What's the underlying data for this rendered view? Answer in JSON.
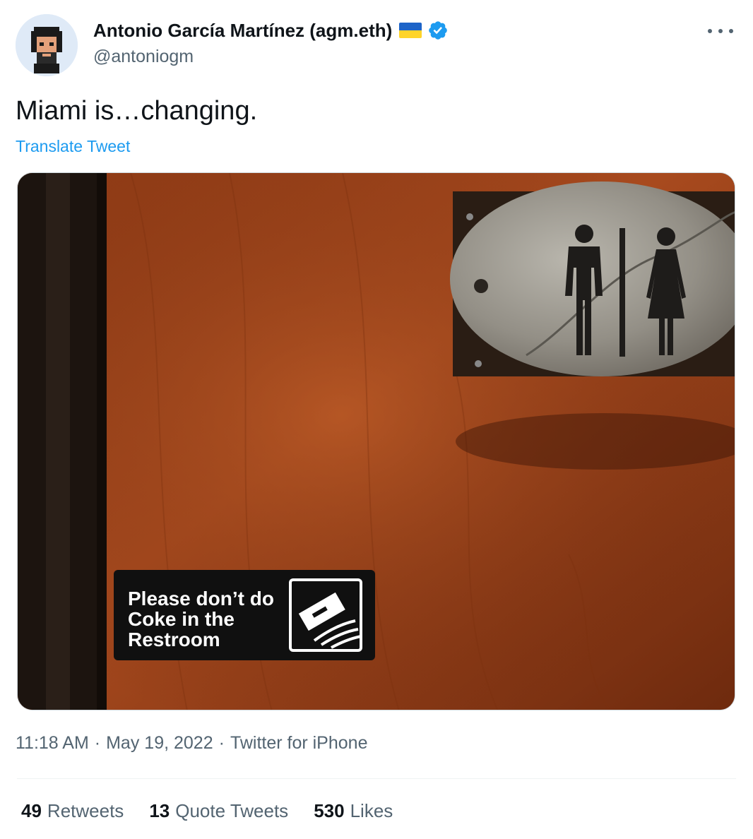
{
  "author": {
    "display_name": "Antonio García Martínez (agm.eth)",
    "handle": "@antoniogm",
    "flag": "ukraine-flag-icon",
    "verified": "verified-badge-icon"
  },
  "tweet": {
    "text": "Miami is…changing.",
    "translate_label": "Translate Tweet"
  },
  "media": {
    "sign_lines": [
      "Please don’t do",
      "Coke in the",
      "Restroom"
    ]
  },
  "meta": {
    "time": "11:18 AM",
    "separator": "·",
    "date": "May 19, 2022",
    "source": "Twitter for iPhone"
  },
  "stats": [
    {
      "count": "49",
      "label": "Retweets"
    },
    {
      "count": "13",
      "label": "Quote Tweets"
    },
    {
      "count": "530",
      "label": "Likes"
    }
  ],
  "colors": {
    "accent": "#1d9bf0",
    "secondary_text": "#536471",
    "primary_text": "#0f1419"
  }
}
